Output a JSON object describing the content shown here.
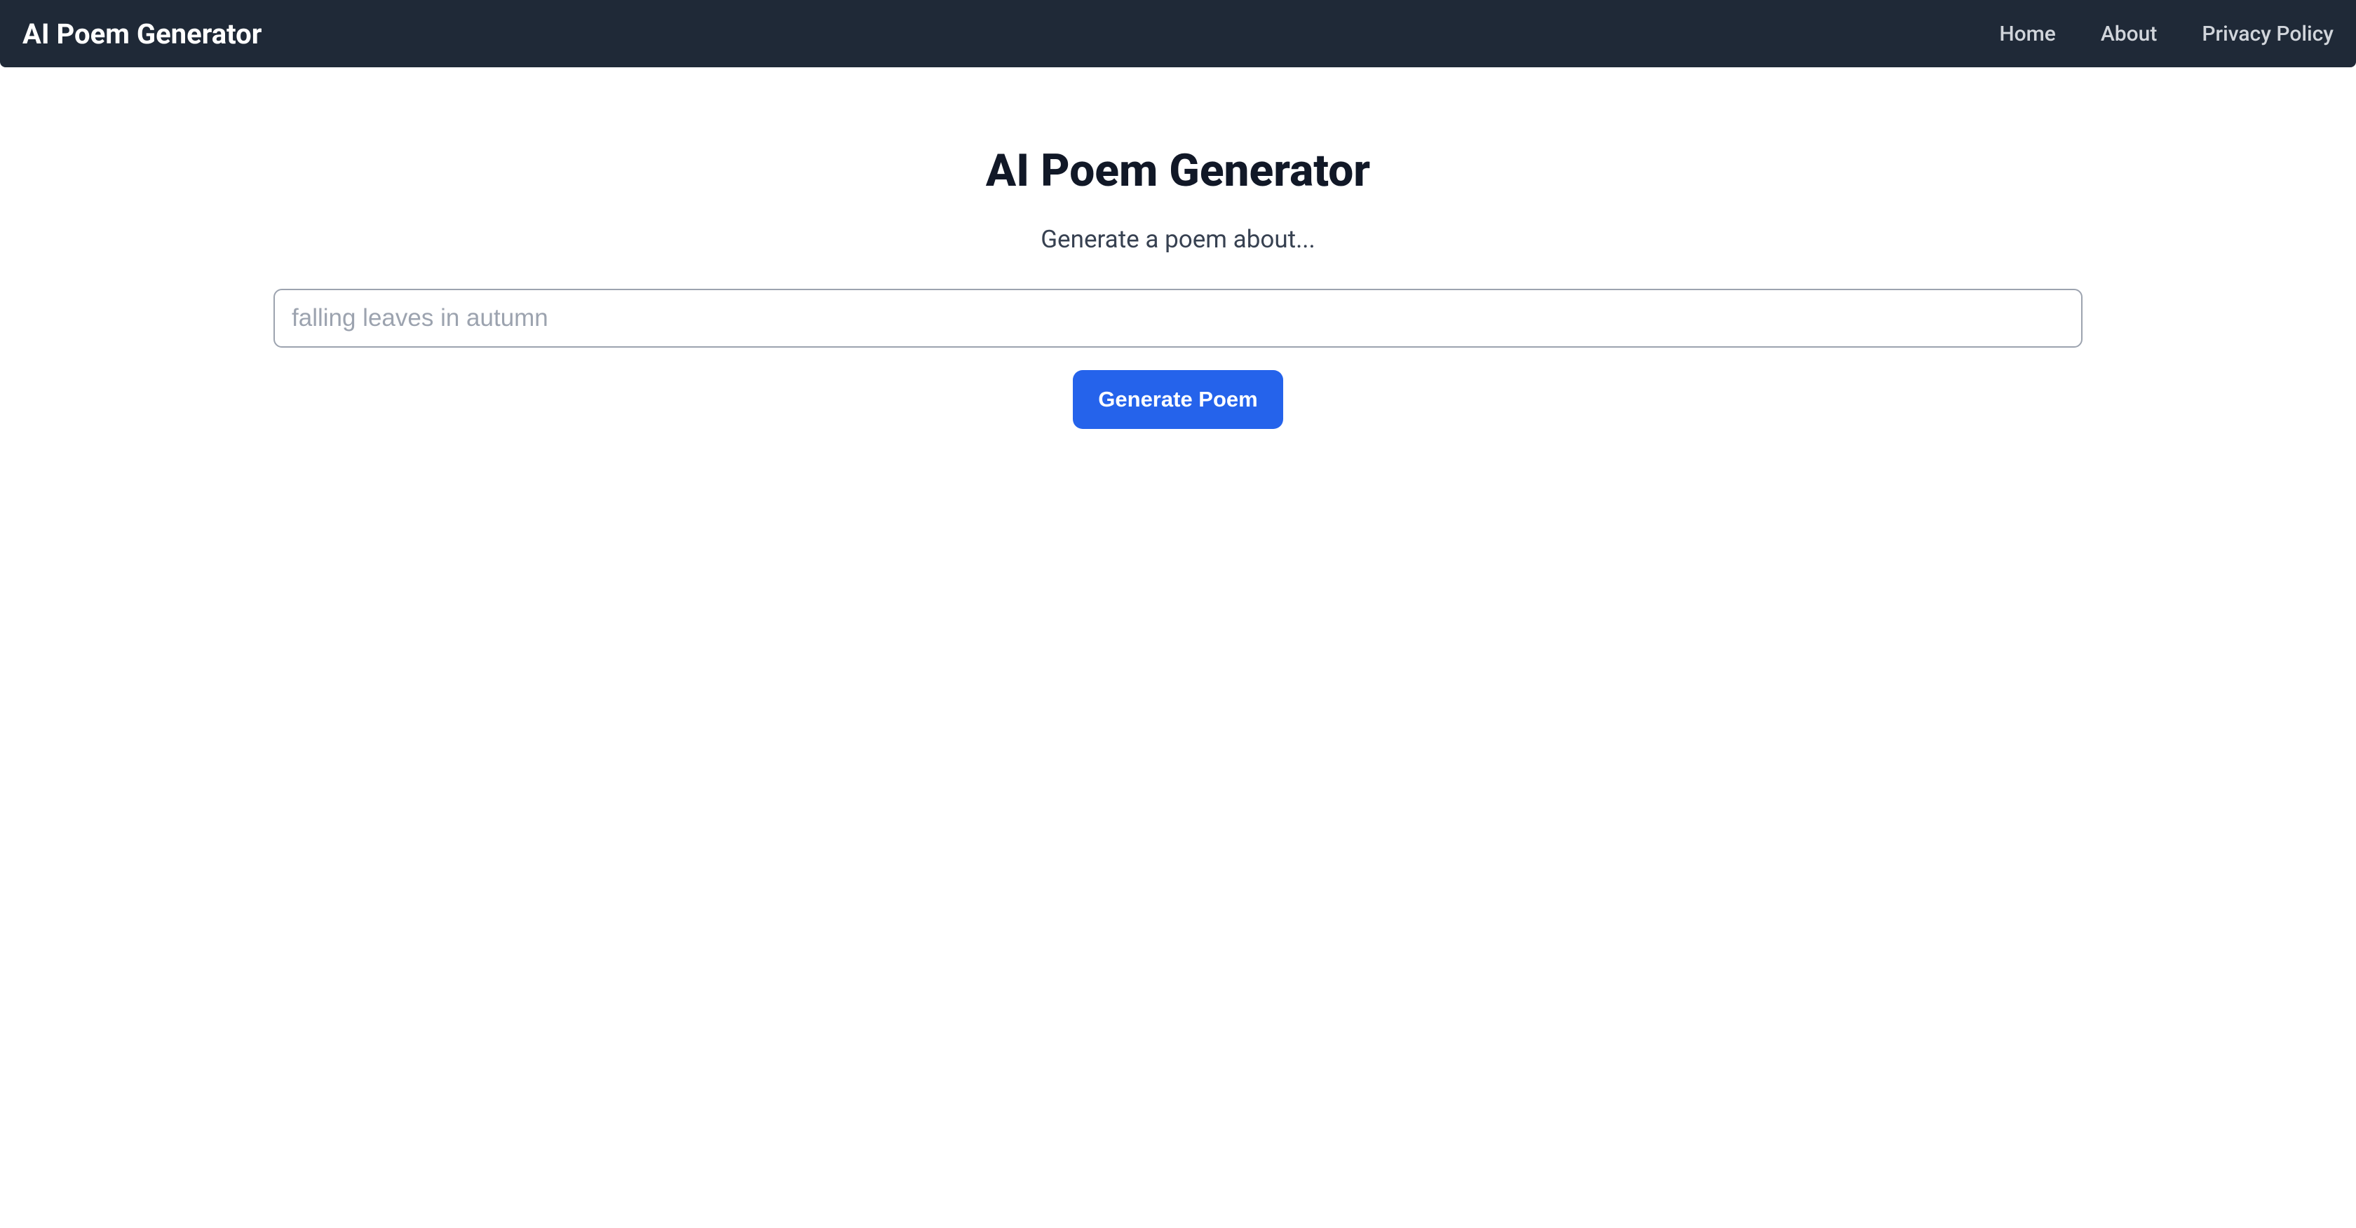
{
  "navbar": {
    "brand": "AI Poem Generator",
    "links": [
      {
        "label": "Home"
      },
      {
        "label": "About"
      },
      {
        "label": "Privacy Policy"
      }
    ]
  },
  "main": {
    "title": "AI Poem Generator",
    "subtitle": "Generate a poem about...",
    "input_placeholder": "falling leaves in autumn",
    "input_value": "",
    "button_label": "Generate Poem"
  }
}
